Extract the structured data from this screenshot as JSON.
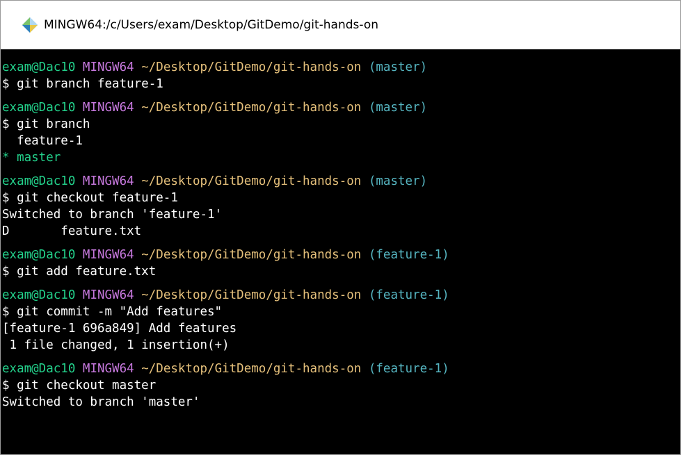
{
  "window": {
    "title": "MINGW64:/c/Users/exam/Desktop/GitDemo/git-hands-on",
    "icon": "git-bash-icon"
  },
  "colors": {
    "user": "#23d18b",
    "system": "#c678dd",
    "path": "#e5c07b",
    "branch": "#56b6c2",
    "text": "#ffffff",
    "background": "#000000"
  },
  "terminal": {
    "blocks": [
      {
        "prompt": {
          "user": "exam@Dac10",
          "system": "MINGW64",
          "path": "~/Desktop/GitDemo/git-hands-on",
          "branch": "(master)"
        },
        "command": "$ git branch feature-1",
        "output": []
      },
      {
        "prompt": {
          "user": "exam@Dac10",
          "system": "MINGW64",
          "path": "~/Desktop/GitDemo/git-hands-on",
          "branch": "(master)"
        },
        "command": "$ git branch",
        "output": [
          {
            "text": "  feature-1",
            "color": "white"
          },
          {
            "text": "* master",
            "color": "green"
          }
        ]
      },
      {
        "prompt": {
          "user": "exam@Dac10",
          "system": "MINGW64",
          "path": "~/Desktop/GitDemo/git-hands-on",
          "branch": "(master)"
        },
        "command": "$ git checkout feature-1",
        "output": [
          {
            "text": "Switched to branch 'feature-1'",
            "color": "white"
          },
          {
            "text": "D       feature.txt",
            "color": "white"
          }
        ]
      },
      {
        "prompt": {
          "user": "exam@Dac10",
          "system": "MINGW64",
          "path": "~/Desktop/GitDemo/git-hands-on",
          "branch": "(feature-1)"
        },
        "command": "$ git add feature.txt",
        "output": []
      },
      {
        "prompt": {
          "user": "exam@Dac10",
          "system": "MINGW64",
          "path": "~/Desktop/GitDemo/git-hands-on",
          "branch": "(feature-1)"
        },
        "command": "$ git commit -m \"Add features\"",
        "output": [
          {
            "text": "[feature-1 696a849] Add features",
            "color": "white"
          },
          {
            "text": " 1 file changed, 1 insertion(+)",
            "color": "white"
          }
        ]
      },
      {
        "prompt": {
          "user": "exam@Dac10",
          "system": "MINGW64",
          "path": "~/Desktop/GitDemo/git-hands-on",
          "branch": "(feature-1)"
        },
        "command": "$ git checkout master",
        "output": [
          {
            "text": "Switched to branch 'master'",
            "color": "white"
          }
        ]
      }
    ]
  }
}
